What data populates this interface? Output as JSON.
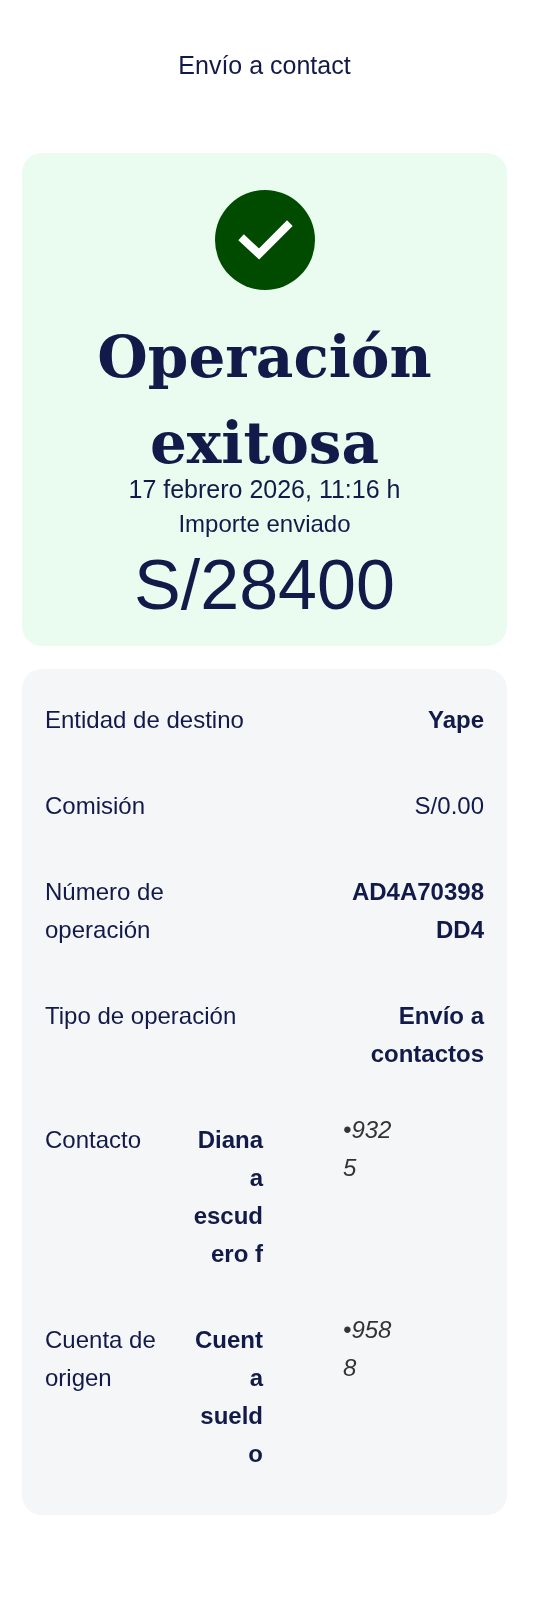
{
  "header": {
    "title": "Envío a contact"
  },
  "result": {
    "title": "Operación exitosa",
    "date": "17 febrero 2026, 11:16 h",
    "amount_label": "Importe enviado",
    "amount": "S/28400"
  },
  "details": [
    {
      "kind": "pair",
      "label": "Entidad de destino",
      "value": "Yape",
      "bold": true
    },
    {
      "kind": "pair",
      "label": "Comisión",
      "value": "S/0.00",
      "bold": false
    },
    {
      "kind": "pair",
      "label": "Número de\noperación",
      "value": "AD4A70398\nDD4",
      "bold": true
    },
    {
      "kind": "pair",
      "label": "Tipo de operación",
      "value": "Envío a\ncontactos",
      "bold": true
    },
    {
      "kind": "triple",
      "label": "Contacto",
      "value": "Diana\na\nescud\nero f",
      "extra": "•932\n5"
    },
    {
      "kind": "triple",
      "label": "Cuenta de\norigen",
      "value": "Cuent\na\nsueld\no",
      "extra": "•958\n8"
    }
  ]
}
